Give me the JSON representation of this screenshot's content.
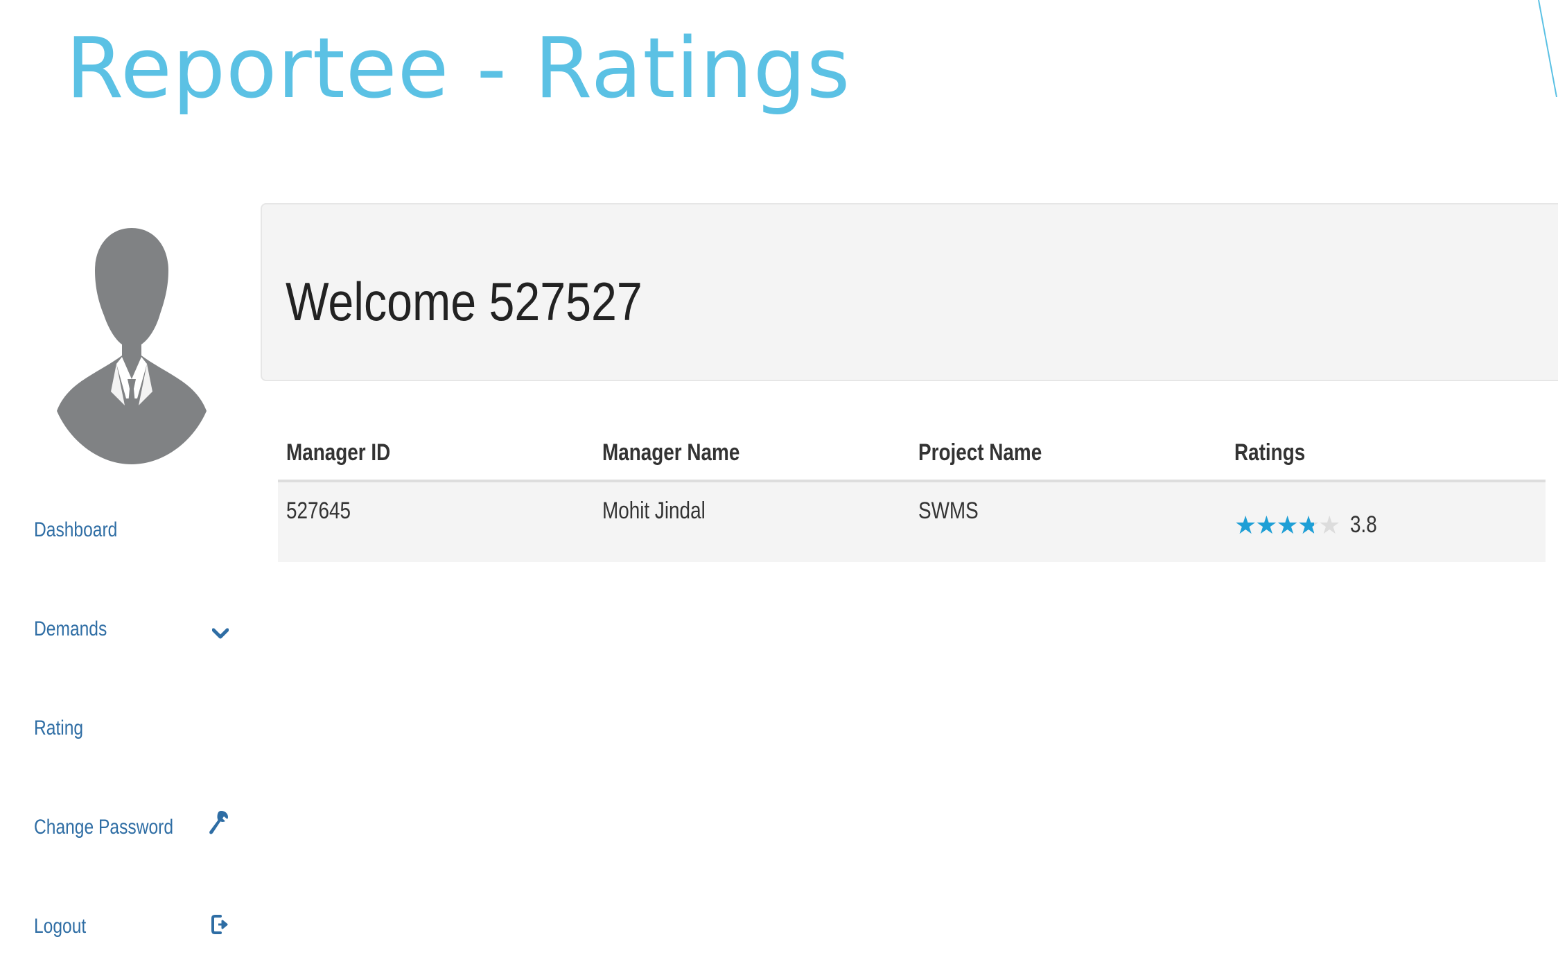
{
  "slide": {
    "title": "Reportee - Ratings",
    "accent_color": "#5bc1e4"
  },
  "sidebar": {
    "avatar_icon": "user-silhouette-icon",
    "items": [
      {
        "label": "Dashboard",
        "icon": ""
      },
      {
        "label": "Demands",
        "icon": "chevron-down-icon"
      },
      {
        "label": "Rating",
        "icon": ""
      },
      {
        "label": "Change Password",
        "icon": "wrench-icon"
      },
      {
        "label": "Logout",
        "icon": "logout-icon"
      }
    ],
    "link_color": "#2e6da4"
  },
  "main": {
    "welcome": "Welcome 527527",
    "table": {
      "headers": [
        "Manager ID",
        "Manager Name",
        "Project Name",
        "Ratings"
      ],
      "rows": [
        {
          "manager_id": "527645",
          "manager_name": "Mohit Jindal",
          "project_name": "SWMS",
          "rating": 3.8,
          "rating_text": "3.8",
          "max_stars": 5
        }
      ]
    },
    "star_color": "#1e9fd6"
  }
}
